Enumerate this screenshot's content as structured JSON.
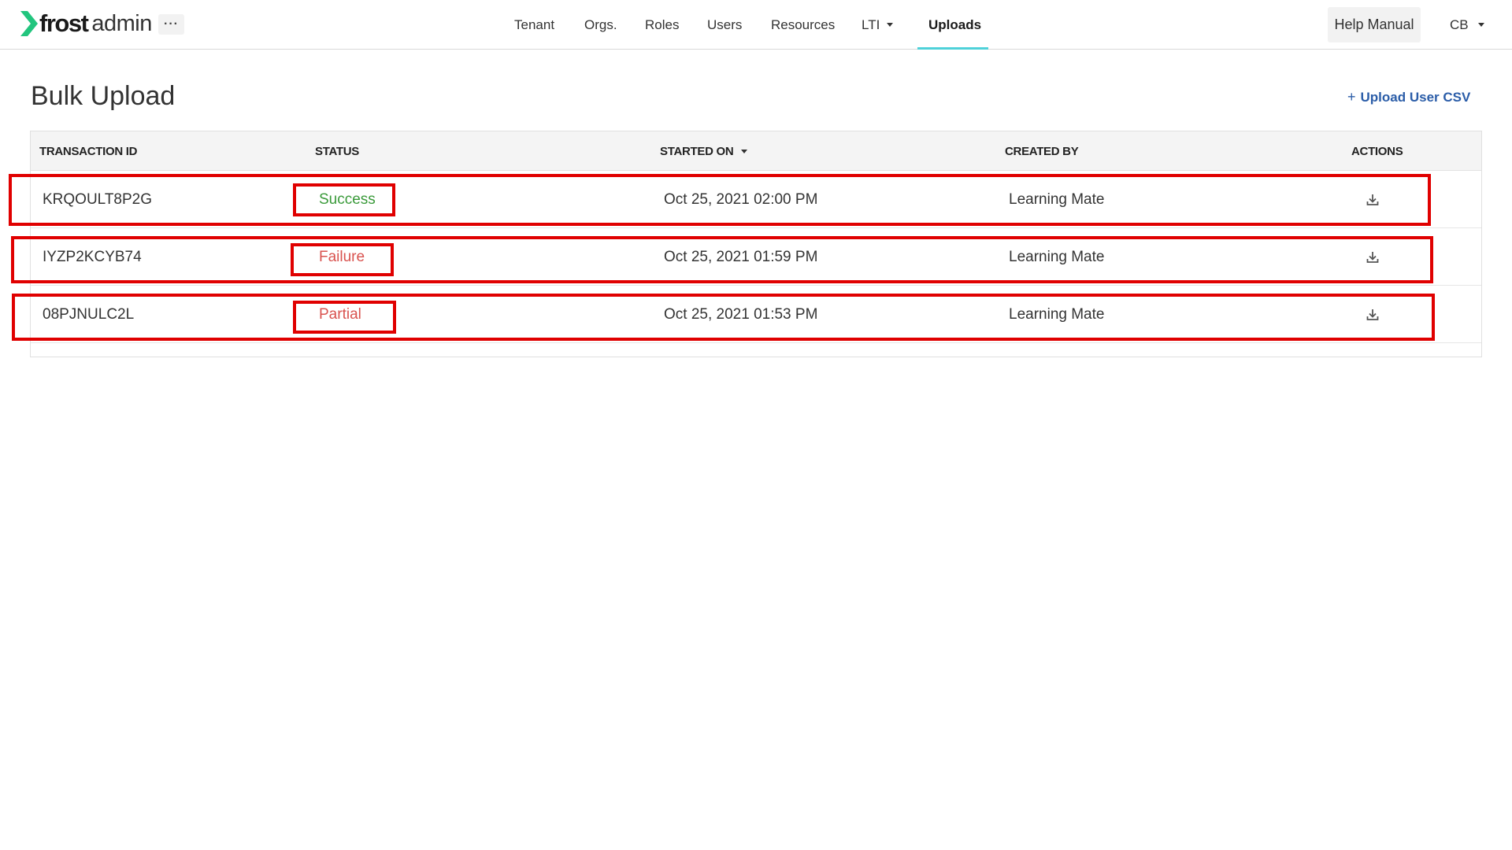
{
  "brand": {
    "name_bold": "frost",
    "name_light": "admin",
    "accent": "#22c57e",
    "more_label": "···"
  },
  "nav": {
    "items": [
      {
        "label": "Tenant"
      },
      {
        "label": "Orgs."
      },
      {
        "label": "Roles"
      },
      {
        "label": "Users"
      },
      {
        "label": "Resources"
      },
      {
        "label": "LTI"
      },
      {
        "label": "Uploads",
        "active": true
      }
    ],
    "active_underline_color": "#4fd1d9",
    "help_label": "Help Manual",
    "user_initials": "CB"
  },
  "page": {
    "title": "Bulk Upload",
    "upload_plus": "+",
    "upload_label": "Upload User CSV",
    "link_color": "#2b5da8"
  },
  "table": {
    "headers": {
      "transaction_id": "TRANSACTION ID",
      "status": "STATUS",
      "started_on": "STARTED ON",
      "created_by": "CREATED BY",
      "actions": "ACTIONS"
    },
    "sort_column": "started_on",
    "sort_direction": "descending",
    "rows": [
      {
        "transaction_id": "KRQOULT8P2G",
        "status": "Success",
        "status_color": "#3a9a3a",
        "started_on": "Oct 25, 2021 02:00 PM",
        "created_by": "Learning Mate",
        "action_icon": "download-icon"
      },
      {
        "transaction_id": "IYZP2KCYB74",
        "status": "Failure",
        "status_color": "#d9534f",
        "started_on": "Oct 25, 2021 01:59 PM",
        "created_by": "Learning Mate",
        "action_icon": "download-icon"
      },
      {
        "transaction_id": "08PJNULC2L",
        "status": "Partial",
        "status_color": "#d9534f",
        "started_on": "Oct 25, 2021 01:53 PM",
        "created_by": "Learning Mate",
        "action_icon": "download-icon"
      }
    ]
  },
  "annotation_color": "#e00000"
}
